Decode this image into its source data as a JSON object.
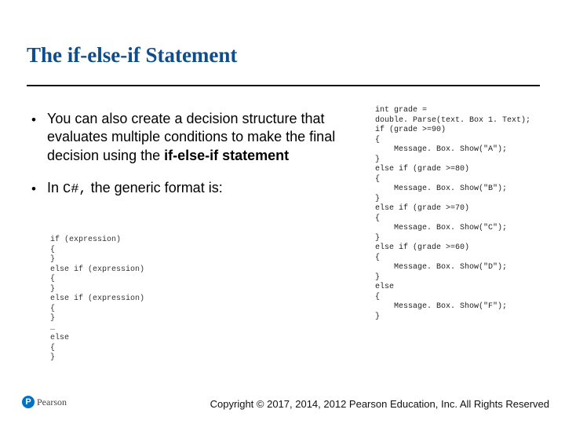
{
  "title": "The if-else-if Statement",
  "bullets": {
    "b1_pre": "You can also create a decision structure that evaluates multiple conditions to make the final decision using the ",
    "b1_bold": "if-else-if statement",
    "b2_pre": "In ",
    "b2_mono": "C#,",
    "b2_post": " the generic format is:"
  },
  "generic_code": "if (expression)\n{\n}\nelse if (expression)\n{\n}\nelse if (expression)\n{\n}\n…\nelse\n{\n}",
  "sample_code": "int grade =\ndouble. Parse(text. Box 1. Text);\nif (grade >=90)\n{\n    Message. Box. Show(\"A\");\n}\nelse if (grade >=80)\n{\n    Message. Box. Show(\"B\");\n}\nelse if (grade >=70)\n{\n    Message. Box. Show(\"C\");\n}\nelse if (grade >=60)\n{\n    Message. Box. Show(\"D\");\n}\nelse\n{\n    Message. Box. Show(\"F\");\n}",
  "logo": {
    "mark": "P",
    "text": "Pearson"
  },
  "copyright": "Copyright © 2017, 2014, 2012 Pearson Education, Inc. All Rights Reserved"
}
